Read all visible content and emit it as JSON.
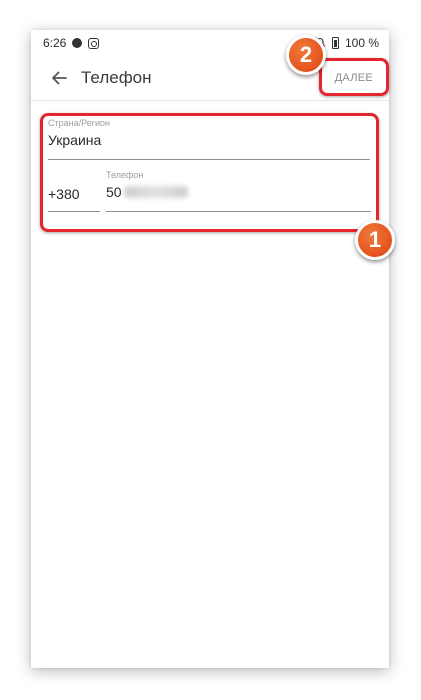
{
  "status_bar": {
    "time": "6:26",
    "battery": "100 %",
    "icons": [
      "circle-icon",
      "app-icon",
      "alarm-icon",
      "bell-off-icon",
      "battery-icon"
    ]
  },
  "app_bar": {
    "title": "Телефон",
    "next_label": "ДАЛЕЕ",
    "back_icon": "arrow-left-icon"
  },
  "form": {
    "country_label": "Страна/Регион",
    "country_value": "Украина",
    "prefix_value": "+380",
    "phone_label": "Телефон",
    "phone_value": "50"
  },
  "annotations": {
    "badge_1": "1",
    "badge_2": "2",
    "highlight_color": "#e3262d",
    "badge_color": "#e4531d"
  }
}
